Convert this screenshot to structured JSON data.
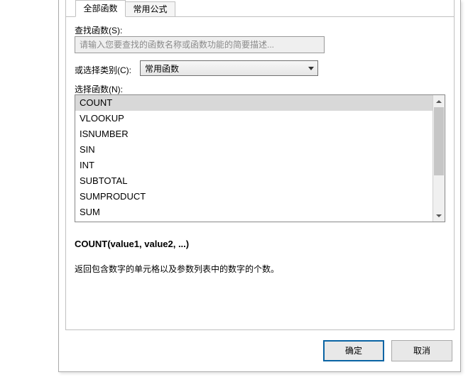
{
  "tabs": {
    "all_functions": "全部函数",
    "common_formulas": "常用公式"
  },
  "labels": {
    "search": "查找函数(S):",
    "search_placeholder": "请输入您要查找的函数名称或函数功能的简要描述...",
    "category": "或选择类别(C):",
    "select_function": "选择函数(N):"
  },
  "category": {
    "selected": "常用函数"
  },
  "functions": [
    "COUNT",
    "VLOOKUP",
    "ISNUMBER",
    "SIN",
    "INT",
    "SUBTOTAL",
    "SUMPRODUCT",
    "SUM"
  ],
  "detail": {
    "signature": "COUNT(value1, value2, ...)",
    "description": "返回包含数字的单元格以及参数列表中的数字的个数。"
  },
  "buttons": {
    "ok": "确定",
    "cancel": "取消"
  }
}
